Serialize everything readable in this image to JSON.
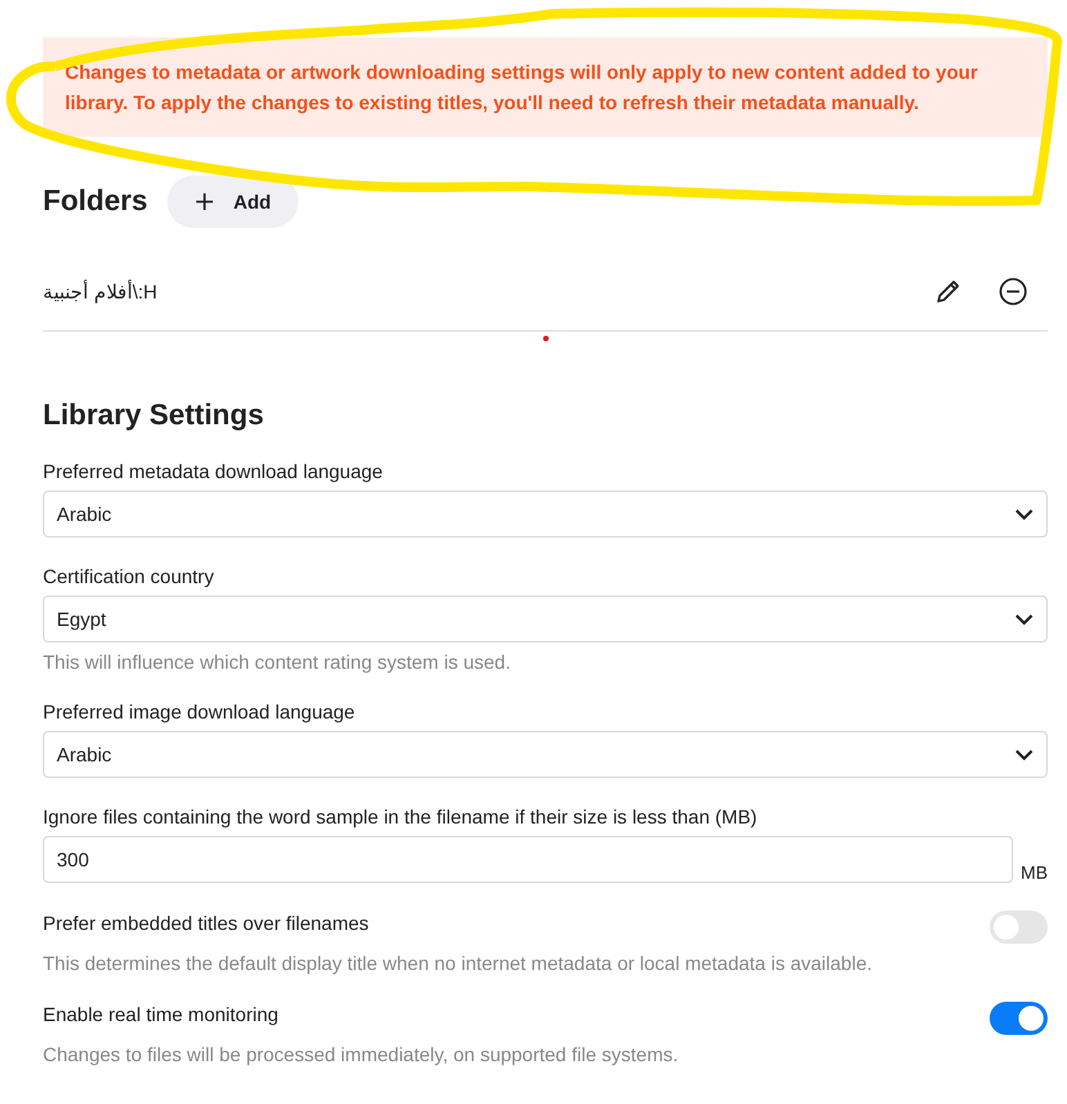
{
  "notice": "Changes to metadata or artwork downloading settings will only apply to new content added to your library. To apply the changes to existing titles, you'll need to refresh their metadata manually.",
  "folders": {
    "title": "Folders",
    "add_label": "Add",
    "items": [
      {
        "path": "H:\\أفلام أجنبية"
      }
    ]
  },
  "library": {
    "title": "Library Settings",
    "settings": [
      {
        "kind": "select",
        "label": "Preferred metadata download language",
        "value": "Arabic"
      },
      {
        "kind": "select",
        "label": "Certification country",
        "value": "Egypt",
        "help": "This will influence which content rating system is used."
      },
      {
        "kind": "select",
        "label": "Preferred image download language",
        "value": "Arabic"
      },
      {
        "kind": "number",
        "label": "Ignore files containing the word sample in the filename if their size is less than (MB)",
        "value": "300",
        "unit": "MB"
      },
      {
        "kind": "toggle",
        "label": "Prefer embedded titles over filenames",
        "on": false,
        "help": "This determines the default display title when no internet metadata or local metadata is available."
      },
      {
        "kind": "toggle",
        "label": "Enable real time monitoring",
        "on": true,
        "help": "Changes to files will be processed immediately, on supported file systems."
      }
    ]
  }
}
